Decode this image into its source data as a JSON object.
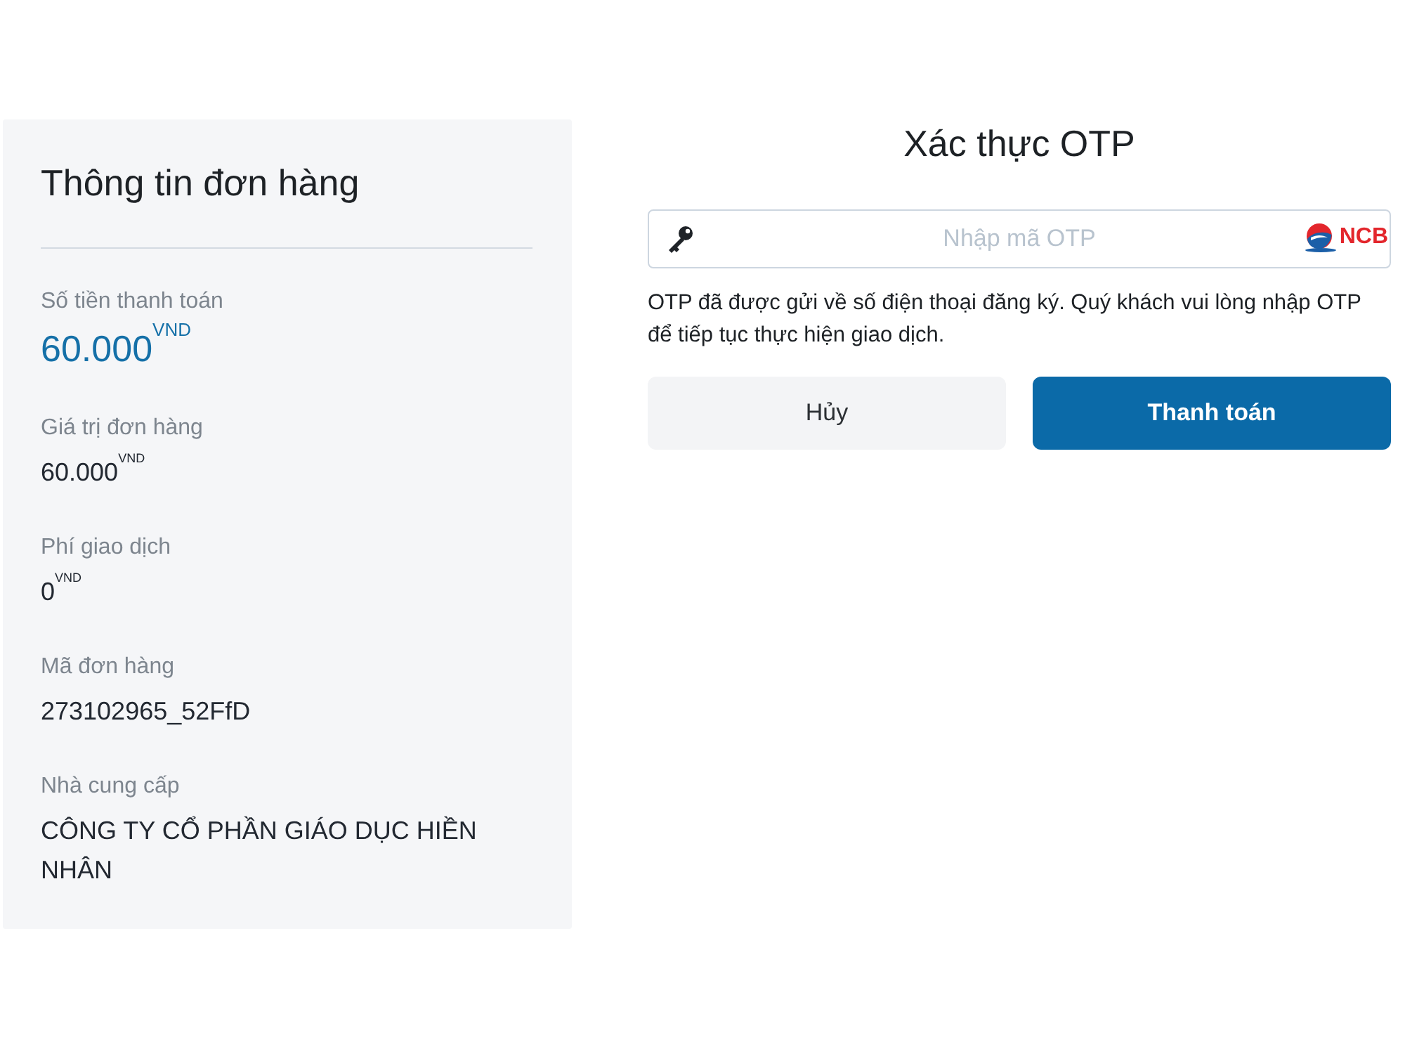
{
  "order_info": {
    "title": "Thông tin đơn hàng",
    "fields": [
      {
        "kind": "amount",
        "label": "Số tiền thanh toán",
        "value": "60.000$^{VND}$"
      },
      {
        "kind": "plain",
        "label": "Giá trị đơn hàng",
        "value": "60.000$^{VND}$"
      },
      {
        "kind": "plain",
        "label": "Phí giao dịch",
        "value": "0$^{VND}$"
      },
      {
        "kind": "plain",
        "label": "Mã đơn hàng",
        "value": "273102965_52FfD"
      },
      {
        "kind": "plain",
        "label": "Nhà cung cấp",
        "value": "CÔNG TY CỔ PHẦN GIÁO DỤC HIỀN NHÂN"
      }
    ]
  },
  "otp": {
    "title": "Xác thực OTP",
    "input": {
      "placeholder": "Nhập mã OTP"
    },
    "bank_logo": {
      "text": "NCB"
    },
    "message": "OTP đã được gửi về số điện thoại đăng ký. Quý khách vui lòng nhập OTP để tiếp tục thực hiện giao dịch.",
    "buttons": [
      {
        "kind": "secondary",
        "label": "Hủy"
      },
      {
        "kind": "primary",
        "label": "Thanh toán"
      }
    ]
  }
}
